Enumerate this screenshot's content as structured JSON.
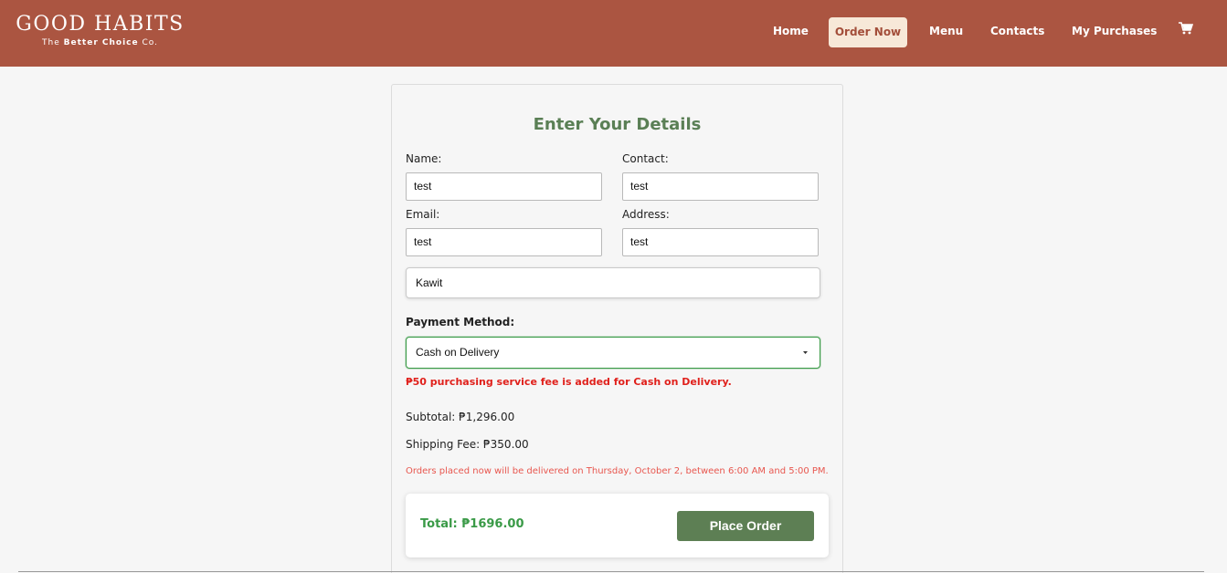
{
  "brand": {
    "name": "GOOD HABITS",
    "tag_prefix": "The ",
    "tag_bold": "Better Choice",
    "tag_suffix": " Co."
  },
  "nav": {
    "home": "Home",
    "order_now": "Order Now",
    "menu": "Menu",
    "contacts": "Contacts",
    "my_purchases": "My Purchases",
    "cart_icon": "cart-icon"
  },
  "form": {
    "title": "Enter Your Details",
    "name_label": "Name:",
    "name_value": "test",
    "contact_label": "Contact:",
    "contact_value": "test",
    "email_label": "Email:",
    "email_value": "test",
    "address_label": "Address:",
    "address_value": "test",
    "location_value": "Kawit",
    "payment_label": "Payment Method:",
    "payment_value": "Cash on Delivery",
    "cod_note": "₱50 purchasing service fee is added for Cash on Delivery.",
    "subtotal": "Subtotal: ₱1,296.00",
    "shipping": "Shipping Fee: ₱350.00",
    "delivery_note": "Orders placed now will be delivered on Thursday, October 2, between 6:00 AM and 5:00 PM.",
    "total": "Total: ₱1696.00",
    "place_order": "Place Order"
  },
  "colors": {
    "header": "#ab5541",
    "accent_green": "#5d7f54",
    "total_green": "#3a9a47",
    "warning_red": "#e0201b"
  }
}
